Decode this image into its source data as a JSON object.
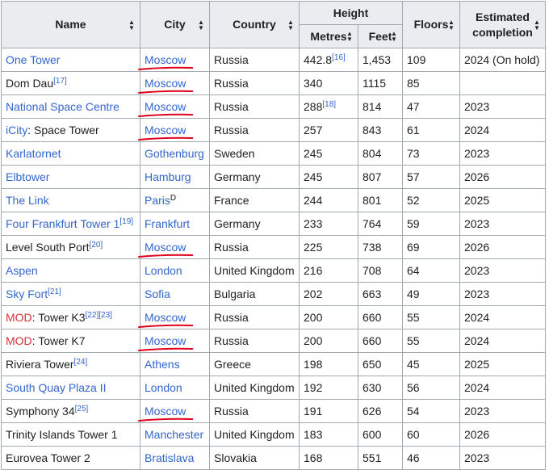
{
  "headers": {
    "name": "Name",
    "city": "City",
    "country": "Country",
    "height": "Height",
    "metres": "Metres",
    "feet": "Feet",
    "floors": "Floors",
    "completion_line1": "Estimated",
    "completion_line2": "completion"
  },
  "sort_icon": "sort-arrows-icon",
  "colors": {
    "link": "#3366cc",
    "redlink": "#d73333",
    "annotation": "#e0001a"
  },
  "rows": [
    {
      "name_parts": [
        {
          "text": "One Tower",
          "kind": "link"
        }
      ],
      "name_ref": "",
      "city": "Moscow",
      "city_ref": "",
      "country": "Russia",
      "metres": "442.8",
      "metres_ref": "[16]",
      "feet": "1,453",
      "floors": "109",
      "completion": "2024 (On hold)",
      "underlined": true
    },
    {
      "name_parts": [
        {
          "text": "Dom Dau",
          "kind": "plain"
        }
      ],
      "name_ref": "[17]",
      "city": "Moscow",
      "city_ref": "",
      "country": "Russia",
      "metres": "340",
      "metres_ref": "",
      "feet": "1115",
      "floors": "85",
      "completion": "",
      "underlined": true
    },
    {
      "name_parts": [
        {
          "text": "National Space Centre",
          "kind": "link"
        }
      ],
      "name_ref": "",
      "city": "Moscow",
      "city_ref": "",
      "country": "Russia",
      "metres": "288",
      "metres_ref": "[18]",
      "feet": "814",
      "floors": "47",
      "completion": "2023",
      "underlined": true
    },
    {
      "name_parts": [
        {
          "text": "iCity",
          "kind": "link"
        },
        {
          "text": ": Space Tower",
          "kind": "plain"
        }
      ],
      "name_ref": "",
      "city": "Moscow",
      "city_ref": "",
      "country": "Russia",
      "metres": "257",
      "metres_ref": "",
      "feet": "843",
      "floors": "61",
      "completion": "2024",
      "underlined": true
    },
    {
      "name_parts": [
        {
          "text": "Karlatornet",
          "kind": "link"
        }
      ],
      "name_ref": "",
      "city": "Gothenburg",
      "city_ref": "",
      "country": "Sweden",
      "metres": "245",
      "metres_ref": "",
      "feet": "804",
      "floors": "73",
      "completion": "2023",
      "underlined": false
    },
    {
      "name_parts": [
        {
          "text": "Elbtower",
          "kind": "link"
        }
      ],
      "name_ref": "",
      "city": "Hamburg",
      "city_ref": "",
      "country": "Germany",
      "metres": "245",
      "metres_ref": "",
      "feet": "807",
      "floors": "57",
      "completion": "2026",
      "underlined": false
    },
    {
      "name_parts": [
        {
          "text": "The Link",
          "kind": "link"
        }
      ],
      "name_ref": "",
      "city": "Paris",
      "city_ref": "D",
      "country": "France",
      "metres": "244",
      "metres_ref": "",
      "feet": "801",
      "floors": "52",
      "completion": "2025",
      "underlined": false
    },
    {
      "name_parts": [
        {
          "text": "Four Frankfurt Tower 1",
          "kind": "link"
        }
      ],
      "name_ref": "[19]",
      "city": "Frankfurt",
      "city_ref": "",
      "country": "Germany",
      "metres": "233",
      "metres_ref": "",
      "feet": "764",
      "floors": "59",
      "completion": "2023",
      "underlined": false
    },
    {
      "name_parts": [
        {
          "text": "Level South Port",
          "kind": "plain"
        }
      ],
      "name_ref": "[20]",
      "city": "Moscow",
      "city_ref": "",
      "country": "Russia",
      "metres": "225",
      "metres_ref": "",
      "feet": "738",
      "floors": "69",
      "completion": "2026",
      "underlined": true
    },
    {
      "name_parts": [
        {
          "text": "Aspen",
          "kind": "link"
        }
      ],
      "name_ref": "",
      "city": "London",
      "city_ref": "",
      "country": "United Kingdom",
      "metres": "216",
      "metres_ref": "",
      "feet": "708",
      "floors": "64",
      "completion": "2023",
      "underlined": false
    },
    {
      "name_parts": [
        {
          "text": "Sky Fort",
          "kind": "link"
        }
      ],
      "name_ref": "[21]",
      "city": "Sofia",
      "city_ref": "",
      "country": "Bulgaria",
      "metres": "202",
      "metres_ref": "",
      "feet": "663",
      "floors": "49",
      "completion": "2023",
      "underlined": false
    },
    {
      "name_parts": [
        {
          "text": "MOD",
          "kind": "redlink"
        },
        {
          "text": ": Tower K3",
          "kind": "plain"
        }
      ],
      "name_ref": "[22][23]",
      "city": "Moscow",
      "city_ref": "",
      "country": "Russia",
      "metres": "200",
      "metres_ref": "",
      "feet": "660",
      "floors": "55",
      "completion": "2024",
      "underlined": true
    },
    {
      "name_parts": [
        {
          "text": "MOD",
          "kind": "redlink"
        },
        {
          "text": ": Tower K7",
          "kind": "plain"
        }
      ],
      "name_ref": "",
      "city": "Moscow",
      "city_ref": "",
      "country": "Russia",
      "metres": "200",
      "metres_ref": "",
      "feet": "660",
      "floors": "55",
      "completion": "2024",
      "underlined": true
    },
    {
      "name_parts": [
        {
          "text": "Riviera Tower",
          "kind": "plain"
        }
      ],
      "name_ref": "[24]",
      "city": "Athens",
      "city_ref": "",
      "country": "Greece",
      "metres": "198",
      "metres_ref": "",
      "feet": "650",
      "floors": "45",
      "completion": "2025",
      "underlined": false
    },
    {
      "name_parts": [
        {
          "text": "South Quay Plaza II",
          "kind": "link"
        }
      ],
      "name_ref": "",
      "city": "London",
      "city_ref": "",
      "country": "United Kingdom",
      "metres": "192",
      "metres_ref": "",
      "feet": "630",
      "floors": "56",
      "completion": "2024",
      "underlined": false
    },
    {
      "name_parts": [
        {
          "text": "Symphony 34",
          "kind": "plain"
        }
      ],
      "name_ref": "[25]",
      "city": "Moscow",
      "city_ref": "",
      "country": "Russia",
      "metres": "191",
      "metres_ref": "",
      "feet": "626",
      "floors": "54",
      "completion": "2023",
      "underlined": true
    },
    {
      "name_parts": [
        {
          "text": "Trinity Islands Tower 1",
          "kind": "plain"
        }
      ],
      "name_ref": "",
      "city": "Manchester",
      "city_ref": "",
      "country": "United Kingdom",
      "metres": "183",
      "metres_ref": "",
      "feet": "600",
      "floors": "60",
      "completion": "2026",
      "underlined": false
    },
    {
      "name_parts": [
        {
          "text": "Eurovea Tower 2",
          "kind": "plain"
        }
      ],
      "name_ref": "",
      "city": "Bratislava",
      "city_ref": "",
      "country": "Slovakia",
      "metres": "168",
      "metres_ref": "",
      "feet": "551",
      "floors": "46",
      "completion": "2023",
      "underlined": false
    }
  ]
}
